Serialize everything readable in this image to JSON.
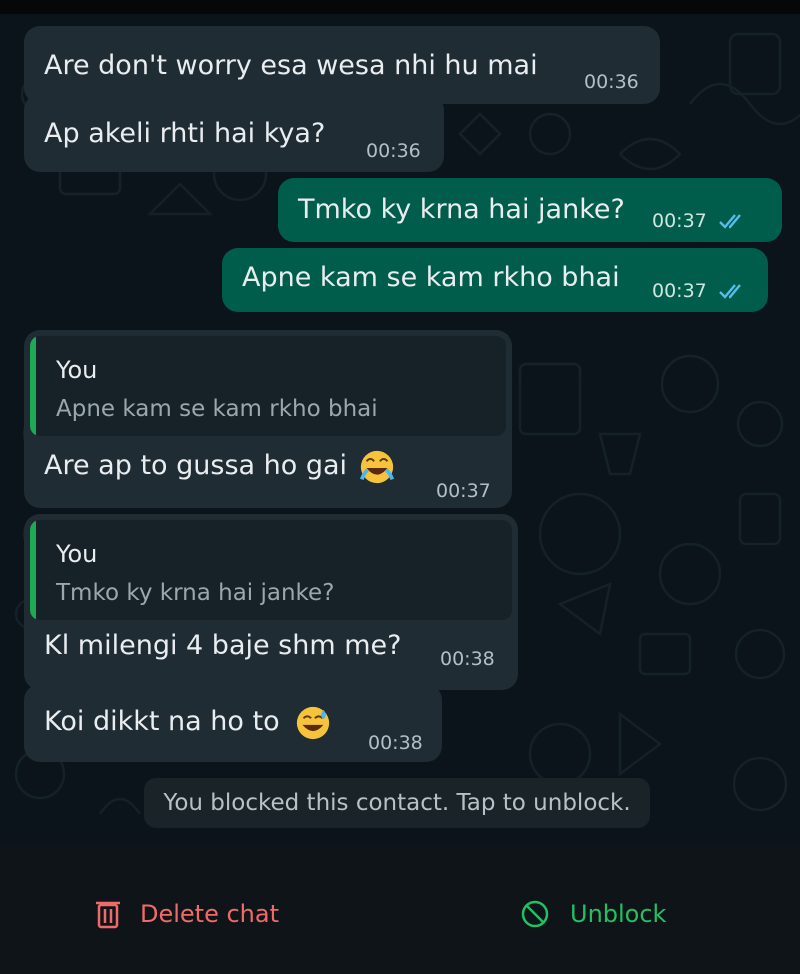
{
  "messages": [
    {
      "text": "Are don't worry esa wesa nhi hu mai",
      "time": "00:36"
    },
    {
      "text": "Ap akeli rhti hai kya?",
      "time": "00:36"
    },
    {
      "text": "Tmko ky krna hai janke?",
      "time": "00:37"
    },
    {
      "text": "Apne kam se kam rkho bhai",
      "time": "00:37"
    },
    {
      "quote_author": "You",
      "quote_text": "Apne kam se kam rkho bhai",
      "text": "Are ap to gussa ho gai",
      "time": "00:37"
    },
    {
      "quote_author": "You",
      "quote_text": "Tmko ky krna hai janke?",
      "text": "Kl milengi 4 baje shm me?",
      "time": "00:38"
    },
    {
      "text": "Koi dikkt na ho to",
      "time": "00:38"
    }
  ],
  "system_message": "You blocked this contact. Tap to unblock.",
  "actions": {
    "delete_label": "Delete chat",
    "unblock_label": "Unblock"
  },
  "colors": {
    "incoming_bubble": "#1f2c34",
    "outgoing_bubble": "#005c4b",
    "quote_accent": "#1fa855",
    "delete": "#f16a6a",
    "unblock": "#21c063",
    "read_ticks": "#53bdeb"
  },
  "icons": {
    "delete": "trash-icon",
    "unblock": "block-icon",
    "read": "double-check-icon",
    "emoji_laugh": "tears-of-joy-emoji",
    "emoji_sweat": "grinning-sweat-emoji"
  }
}
